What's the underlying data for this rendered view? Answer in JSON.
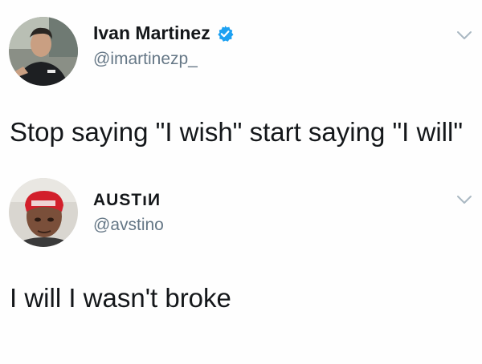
{
  "tweets": [
    {
      "display_name": "Ivan Martinez",
      "handle": "@imartinezp_",
      "verified": true,
      "text": "Stop saying \"I wish\" start saying \"I will\"",
      "avatar": "profile-photo"
    },
    {
      "display_name": "AUSTıИ",
      "handle": "@avstino",
      "verified": false,
      "text": "I will I wasn't broke",
      "avatar": "profile-photo"
    }
  ],
  "icons": {
    "verified": "verified-badge-icon",
    "menu": "chevron-down-icon"
  },
  "colors": {
    "verified_blue": "#1da1f2",
    "handle_gray": "#657786",
    "text_dark": "#14171a",
    "chevron_gray": "#aab8c2"
  }
}
